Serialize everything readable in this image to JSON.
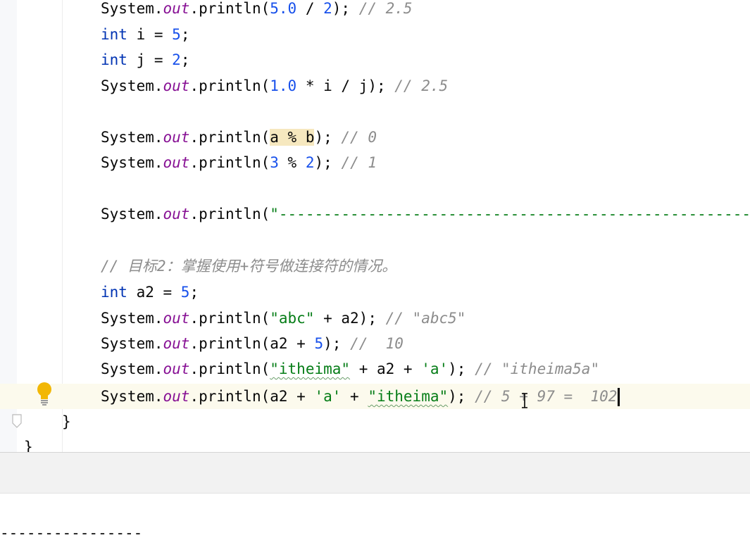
{
  "editor": {
    "lines": [
      {
        "segments": [
          {
            "t": "System.",
            "c": ""
          },
          {
            "t": "out",
            "c": "fld"
          },
          {
            "t": ".println(",
            "c": ""
          },
          {
            "t": "5.0",
            "c": "num"
          },
          {
            "t": " / ",
            "c": ""
          },
          {
            "t": "2",
            "c": "num"
          },
          {
            "t": "); ",
            "c": ""
          },
          {
            "t": "// 2.5",
            "c": "cmt"
          }
        ]
      },
      {
        "segments": [
          {
            "t": "int",
            "c": "kw"
          },
          {
            "t": " i = ",
            "c": ""
          },
          {
            "t": "5",
            "c": "num"
          },
          {
            "t": ";",
            "c": ""
          }
        ]
      },
      {
        "segments": [
          {
            "t": "int",
            "c": "kw"
          },
          {
            "t": " j = ",
            "c": ""
          },
          {
            "t": "2",
            "c": "num"
          },
          {
            "t": ";",
            "c": ""
          }
        ]
      },
      {
        "segments": [
          {
            "t": "System.",
            "c": ""
          },
          {
            "t": "out",
            "c": "fld"
          },
          {
            "t": ".println(",
            "c": ""
          },
          {
            "t": "1.0",
            "c": "num"
          },
          {
            "t": " * i / j); ",
            "c": ""
          },
          {
            "t": "// 2.5",
            "c": "cmt"
          }
        ]
      },
      {
        "segments": [
          {
            "t": "System.",
            "c": ""
          },
          {
            "t": "out",
            "c": "fld"
          },
          {
            "t": ".println(",
            "c": ""
          },
          {
            "t": "a % b",
            "c": "hl"
          },
          {
            "t": "); ",
            "c": ""
          },
          {
            "t": "// 0",
            "c": "cmt"
          }
        ]
      },
      {
        "segments": [
          {
            "t": "System.",
            "c": ""
          },
          {
            "t": "out",
            "c": "fld"
          },
          {
            "t": ".println(",
            "c": ""
          },
          {
            "t": "3",
            "c": "num"
          },
          {
            "t": " % ",
            "c": ""
          },
          {
            "t": "2",
            "c": "num"
          },
          {
            "t": "); ",
            "c": ""
          },
          {
            "t": "// 1",
            "c": "cmt"
          }
        ]
      },
      {
        "segments": [
          {
            "t": "System.",
            "c": ""
          },
          {
            "t": "out",
            "c": "fld"
          },
          {
            "t": ".println(",
            "c": ""
          },
          {
            "t": "\"----------------------------------------------------------",
            "c": "str"
          }
        ]
      },
      {
        "segments": [
          {
            "t": "// 目标2：掌握使用+符号做连接符的情况。",
            "c": "cmt"
          }
        ]
      },
      {
        "segments": [
          {
            "t": "int",
            "c": "kw"
          },
          {
            "t": " a2 = ",
            "c": ""
          },
          {
            "t": "5",
            "c": "num"
          },
          {
            "t": ";",
            "c": ""
          }
        ]
      },
      {
        "segments": [
          {
            "t": "System.",
            "c": ""
          },
          {
            "t": "out",
            "c": "fld"
          },
          {
            "t": ".println(",
            "c": ""
          },
          {
            "t": "\"abc\"",
            "c": "str"
          },
          {
            "t": " + a2); ",
            "c": ""
          },
          {
            "t": "// \"abc5\"",
            "c": "cmt"
          }
        ]
      },
      {
        "segments": [
          {
            "t": "System.",
            "c": ""
          },
          {
            "t": "out",
            "c": "fld"
          },
          {
            "t": ".println(a2 + ",
            "c": ""
          },
          {
            "t": "5",
            "c": "num"
          },
          {
            "t": "); ",
            "c": ""
          },
          {
            "t": "//  10",
            "c": "cmt"
          }
        ]
      },
      {
        "segments": [
          {
            "t": "System.",
            "c": ""
          },
          {
            "t": "out",
            "c": "fld"
          },
          {
            "t": ".println(",
            "c": ""
          },
          {
            "t": "\"itheima\"",
            "c": "str squig"
          },
          {
            "t": " + a2 + ",
            "c": ""
          },
          {
            "t": "'a'",
            "c": "str"
          },
          {
            "t": "); ",
            "c": ""
          },
          {
            "t": "// \"itheima5a\"",
            "c": "cmt"
          }
        ]
      },
      {
        "segments": [
          {
            "t": "System.",
            "c": ""
          },
          {
            "t": "out",
            "c": "fld"
          },
          {
            "t": ".println(a2 + ",
            "c": ""
          },
          {
            "t": "'a'",
            "c": "str"
          },
          {
            "t": " + ",
            "c": ""
          },
          {
            "t": "\"itheima\"",
            "c": "str squig"
          },
          {
            "t": "); ",
            "c": ""
          },
          {
            "t": "// 5 + 97 =  102",
            "c": "cmt"
          }
        ]
      }
    ],
    "closing_brace_method": "}",
    "closing_brace_class": "}"
  },
  "console": {
    "output_line": "----------------"
  },
  "colors": {
    "keyword": "#0033b3",
    "number": "#1750eb",
    "static_field": "#871094",
    "string": "#067d17",
    "comment": "#8c8c8c",
    "current_line": "#fcfaed",
    "intention_bulb": "#f2b705"
  },
  "icons": {
    "intention": "lightbulb-icon",
    "fold": "fold-marker-icon",
    "cursor": "text-cursor-icon"
  }
}
